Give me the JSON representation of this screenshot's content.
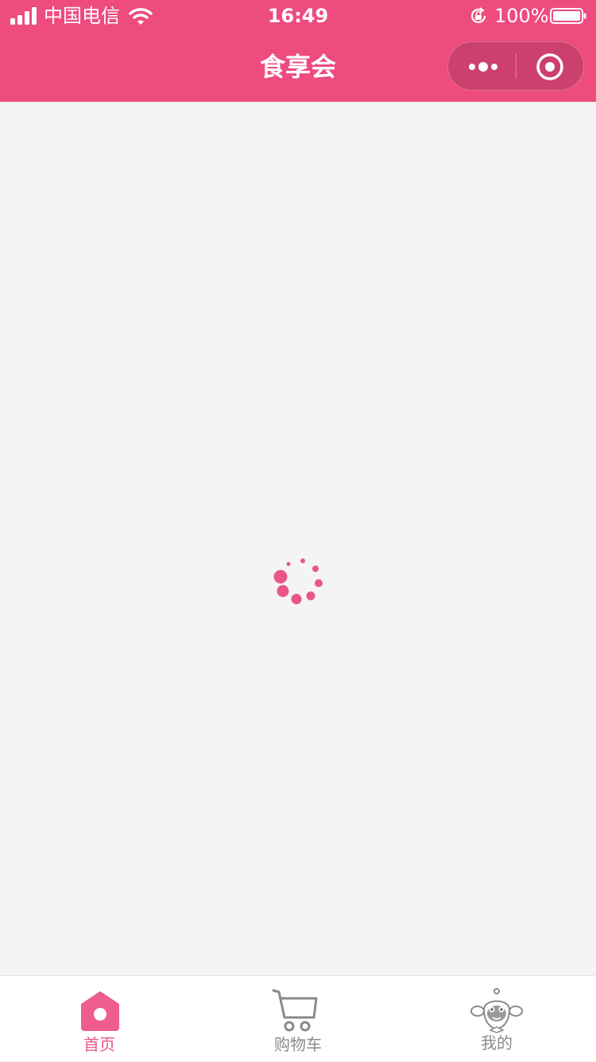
{
  "status_bar": {
    "carrier": "中国电信",
    "time": "16:49",
    "battery_percent": "100%",
    "battery_level": 1.0,
    "icons": [
      "signal-icon",
      "wifi-icon",
      "orientation-lock-icon",
      "battery-icon"
    ]
  },
  "nav": {
    "title": "食享会",
    "capsule_icons": [
      "more-icon",
      "close-target-icon"
    ]
  },
  "content": {
    "loading_icon": "loading-spinner-icon"
  },
  "tabbar": {
    "tabs": [
      {
        "label": "首页",
        "icon": "home-icon",
        "active": true
      },
      {
        "label": "购物车",
        "icon": "cart-icon",
        "active": false
      },
      {
        "label": "我的",
        "icon": "mascot-profile-icon",
        "active": false
      }
    ]
  },
  "colors": {
    "brand": "#ee4b7f",
    "active_tab": "#e8568a",
    "inactive_tab": "#8a8a8a",
    "background": "#f4f4f4"
  }
}
